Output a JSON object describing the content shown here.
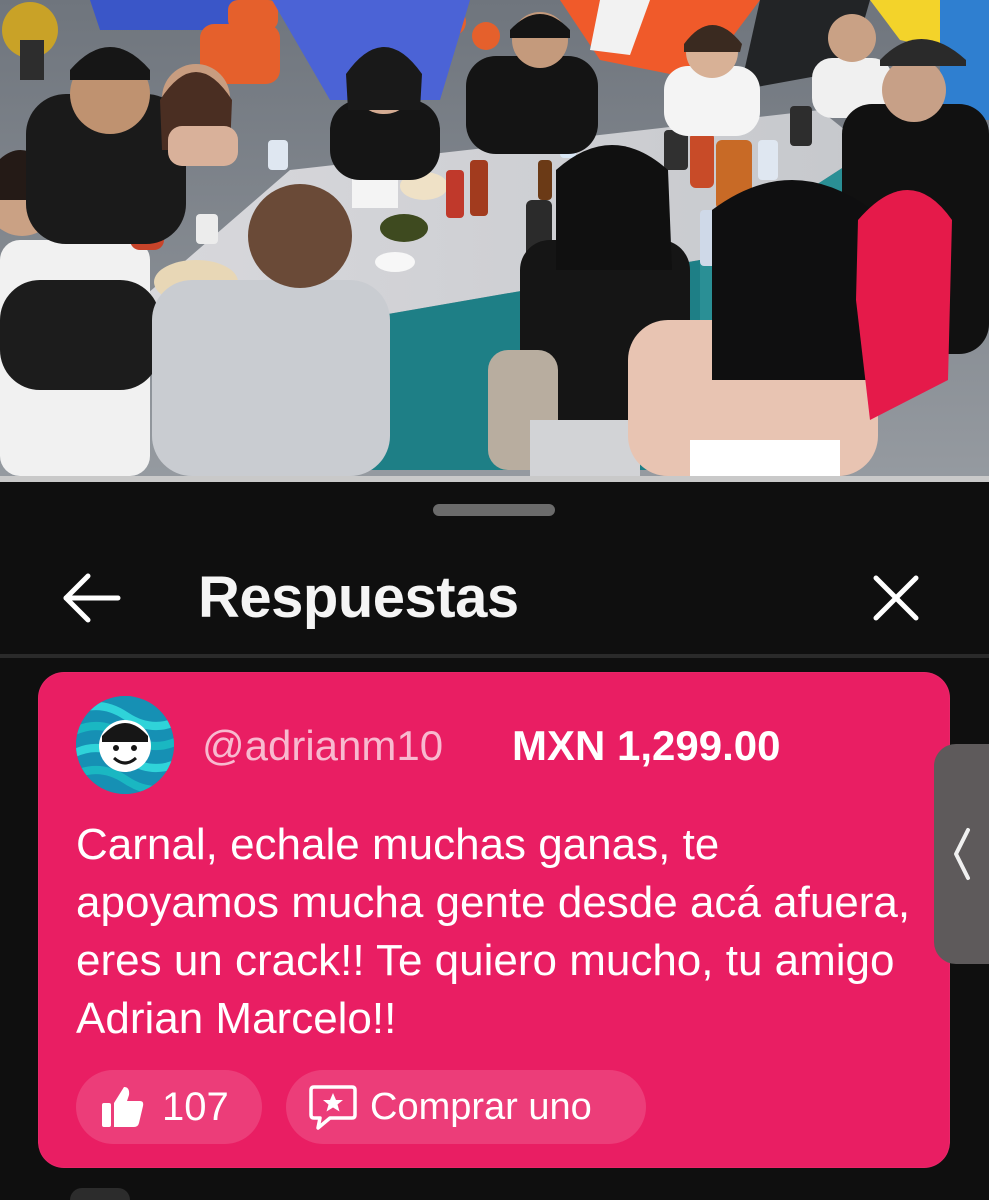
{
  "sheet": {
    "title": "Respuestas",
    "back_icon": "arrow-left-icon",
    "close_icon": "close-x-icon"
  },
  "superchat": {
    "author": "@adrianm10",
    "amount": "MXN 1,299.00",
    "message": "Carnal, echale muchas ganas, te apoyamos mucha gente desde acá afuera, eres un crack!! Te quiero mucho, tu amigo Adrian Marcelo!!",
    "likes": "107",
    "buy_label": "Comprar uno",
    "card_color": "#e91e63"
  },
  "edge_tab": {
    "icon": "chevron-left-icon"
  }
}
